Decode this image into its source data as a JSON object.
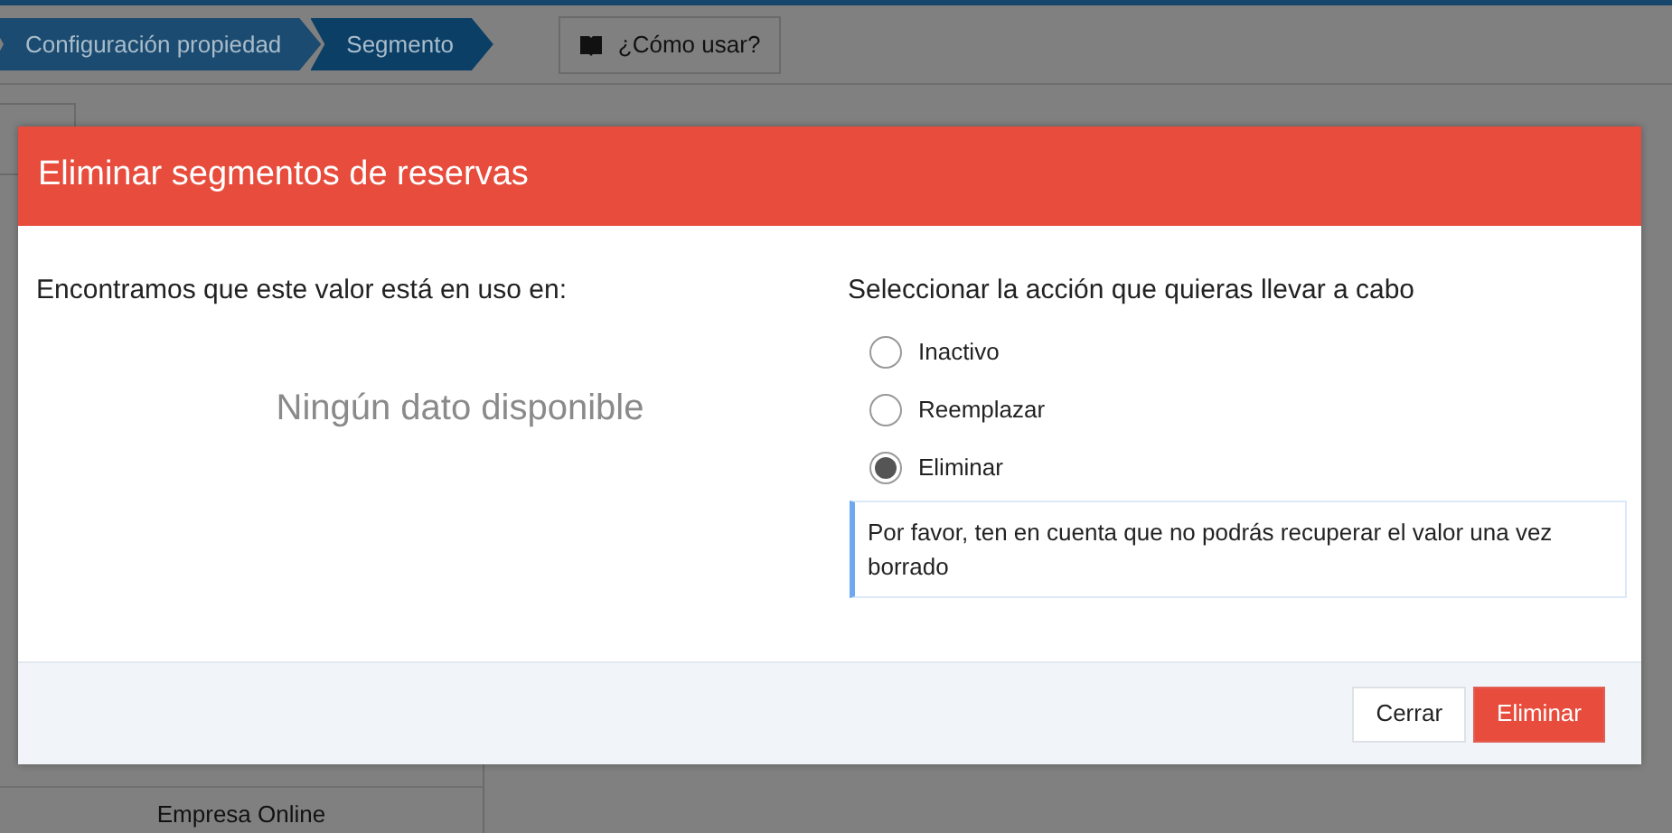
{
  "breadcrumb": [
    {
      "label": "Configuración propiedad",
      "selected": false
    },
    {
      "label": "Segmento",
      "selected": true
    }
  ],
  "help_button": {
    "label": "¿Cómo usar?"
  },
  "table": {
    "rows": [
      "Empresa Online"
    ]
  },
  "dialog": {
    "title": "Eliminar segmentos de reservas",
    "left_heading": "Encontramos que este valor está en uso en:",
    "empty_message": "Ningún dato disponible",
    "right_heading": "Seleccionar la acción que quieras llevar a cabo",
    "options": [
      {
        "label": "Inactivo",
        "selected": false
      },
      {
        "label": "Reemplazar",
        "selected": false
      },
      {
        "label": "Eliminar",
        "selected": true
      }
    ],
    "notice": "Por favor, ten en cuenta que no podrás recuperar el valor una vez borrado",
    "buttons": [
      {
        "label": "Cerrar",
        "kind": "secondary"
      },
      {
        "label": "Eliminar",
        "kind": "danger"
      }
    ]
  }
}
